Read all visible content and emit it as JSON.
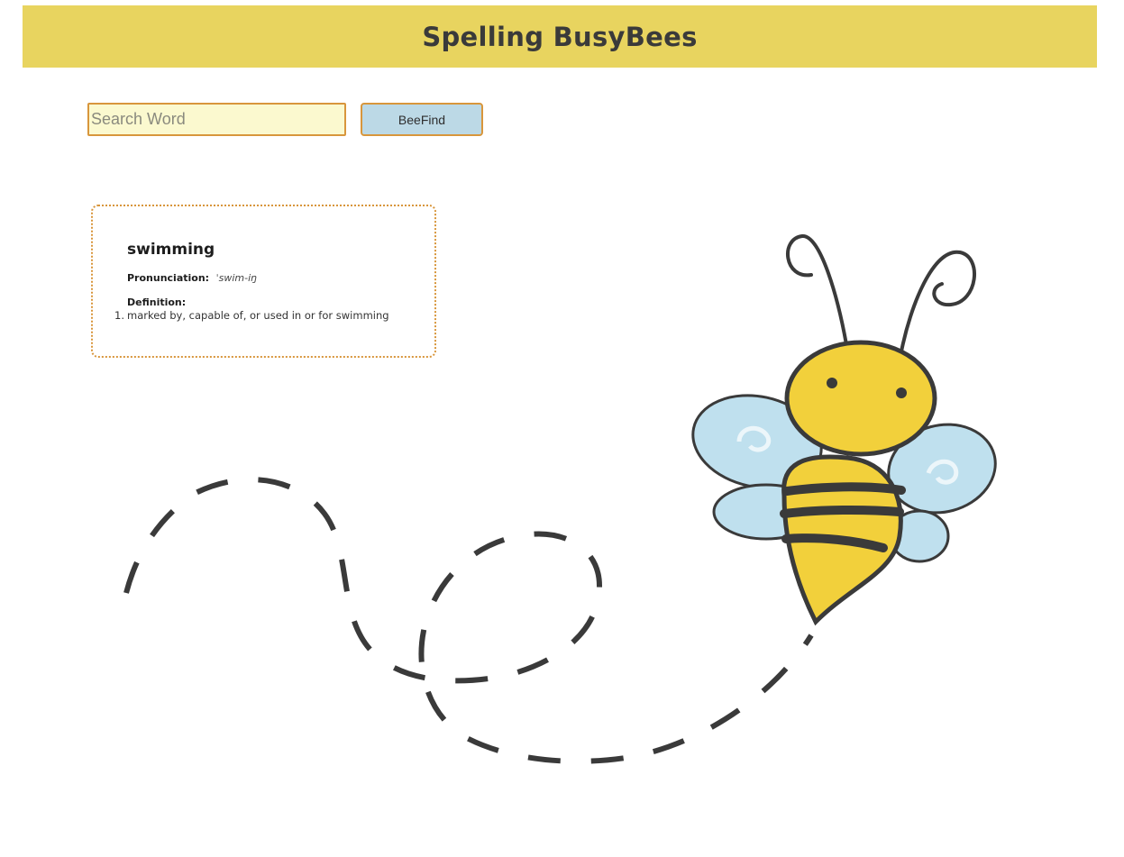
{
  "header": {
    "title": "Spelling BusyBees"
  },
  "search": {
    "placeholder": "Search Word",
    "value": "",
    "button_label": "BeeFind"
  },
  "result": {
    "word": "swimming",
    "pronunciation_label": "Pronunciation:",
    "pronunciation": "ˈswim-iŋ",
    "definition_label": "Definition:",
    "definitions": [
      {
        "number": "1.",
        "text": "marked by, capable of, or used in or for swimming"
      }
    ]
  },
  "colors": {
    "header_bg": "#e8d45f",
    "accent_border": "#d8963c",
    "input_bg": "#fbf9cf",
    "button_bg": "#bcd9e6",
    "bee_yellow": "#f2d03b",
    "bee_wing": "#bfe0ee",
    "ink": "#3a3a3a"
  },
  "icons": {
    "bee": "bee-illustration",
    "flight_path": "dashed-flight-path"
  }
}
